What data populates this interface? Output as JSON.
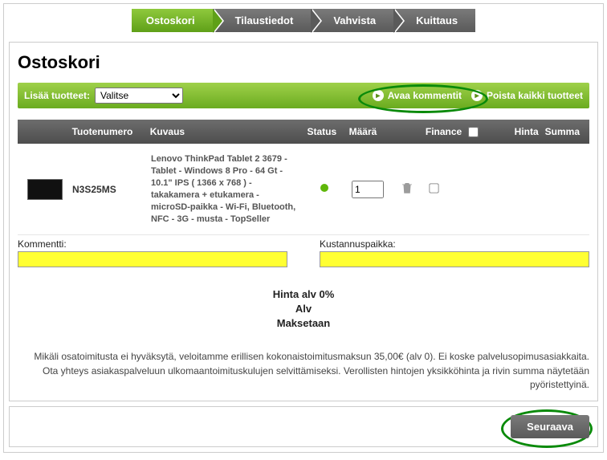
{
  "steps": [
    "Ostoskori",
    "Tilaustiedot",
    "Vahvista",
    "Kuittaus"
  ],
  "page_title": "Ostoskori",
  "actionbar": {
    "add_label": "Lisää tuotteet:",
    "select_value": "Valitse",
    "open_comments": "Avaa kommentit",
    "remove_all": "Poista kaikki tuotteet"
  },
  "headers": {
    "tuotenumero": "Tuotenumero",
    "kuvaus": "Kuvaus",
    "status": "Status",
    "maara": "Määrä",
    "finance": "Finance",
    "hinta": "Hinta",
    "summa": "Summa"
  },
  "row": {
    "sku": "N3S25MS",
    "desc": "Lenovo ThinkPad Tablet 2 3679 - Tablet - Windows 8 Pro - 64 Gt - 10.1\" IPS ( 1366 x 768 ) - takakamera + etukamera - microSD-paikka - Wi-Fi, Bluetooth, NFC - 3G - musta - TopSeller",
    "qty": "1"
  },
  "comments": {
    "kommentti_label": "Kommentti:",
    "kustannuspaikka_label": "Kustannuspaikka:"
  },
  "totals": {
    "hinta0": "Hinta alv 0%",
    "alv": "Alv",
    "maksetaan": "Maksetaan"
  },
  "disclaimer": "Mikäli osatoimitusta ei hyväksytä, veloitamme erillisen kokonaistoimitusmaksun 35,00€ (alv 0). Ei koske palvelusopimusasiakkaita. Ota yhteys asiakaspalveluun ulkomaantoimituskulujen selvittämiseksi. Verollisten hintojen yksikköhinta ja rivin summa näytetään pyöristettyinä.",
  "next_button": "Seuraava"
}
